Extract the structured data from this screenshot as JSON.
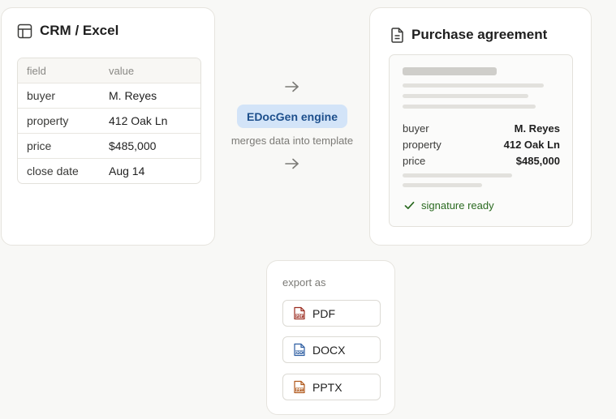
{
  "crm": {
    "title": "CRM / Excel",
    "icon": "table-icon",
    "header": {
      "field": "field",
      "value": "value"
    },
    "rows": [
      {
        "field": "buyer",
        "value": "M. Reyes"
      },
      {
        "field": "property",
        "value": "412 Oak Ln"
      },
      {
        "field": "price",
        "value": "$485,000"
      },
      {
        "field": "close date",
        "value": "Aug 14"
      }
    ]
  },
  "engine": {
    "label": "EDocGen engine",
    "caption": "merges data into template",
    "pill_color": "#d3e4f8",
    "text_color": "#1d4f8c"
  },
  "agreement": {
    "title": "Purchase agreement",
    "icon": "document-icon",
    "fields": [
      {
        "label": "buyer",
        "value": "M. Reyes"
      },
      {
        "label": "property",
        "value": "412 Oak Ln"
      },
      {
        "label": "price",
        "value": "$485,000"
      }
    ],
    "status": "signature ready",
    "status_color": "#2a6a20"
  },
  "export": {
    "label": "export as",
    "formats": [
      {
        "label": "PDF",
        "icon": "pdf-file-icon",
        "color": "#9a2b1f"
      },
      {
        "label": "DOCX",
        "icon": "docx-file-icon",
        "color": "#2a5ba0"
      },
      {
        "label": "PPTX",
        "icon": "pptx-file-icon",
        "color": "#b0581a"
      }
    ]
  }
}
